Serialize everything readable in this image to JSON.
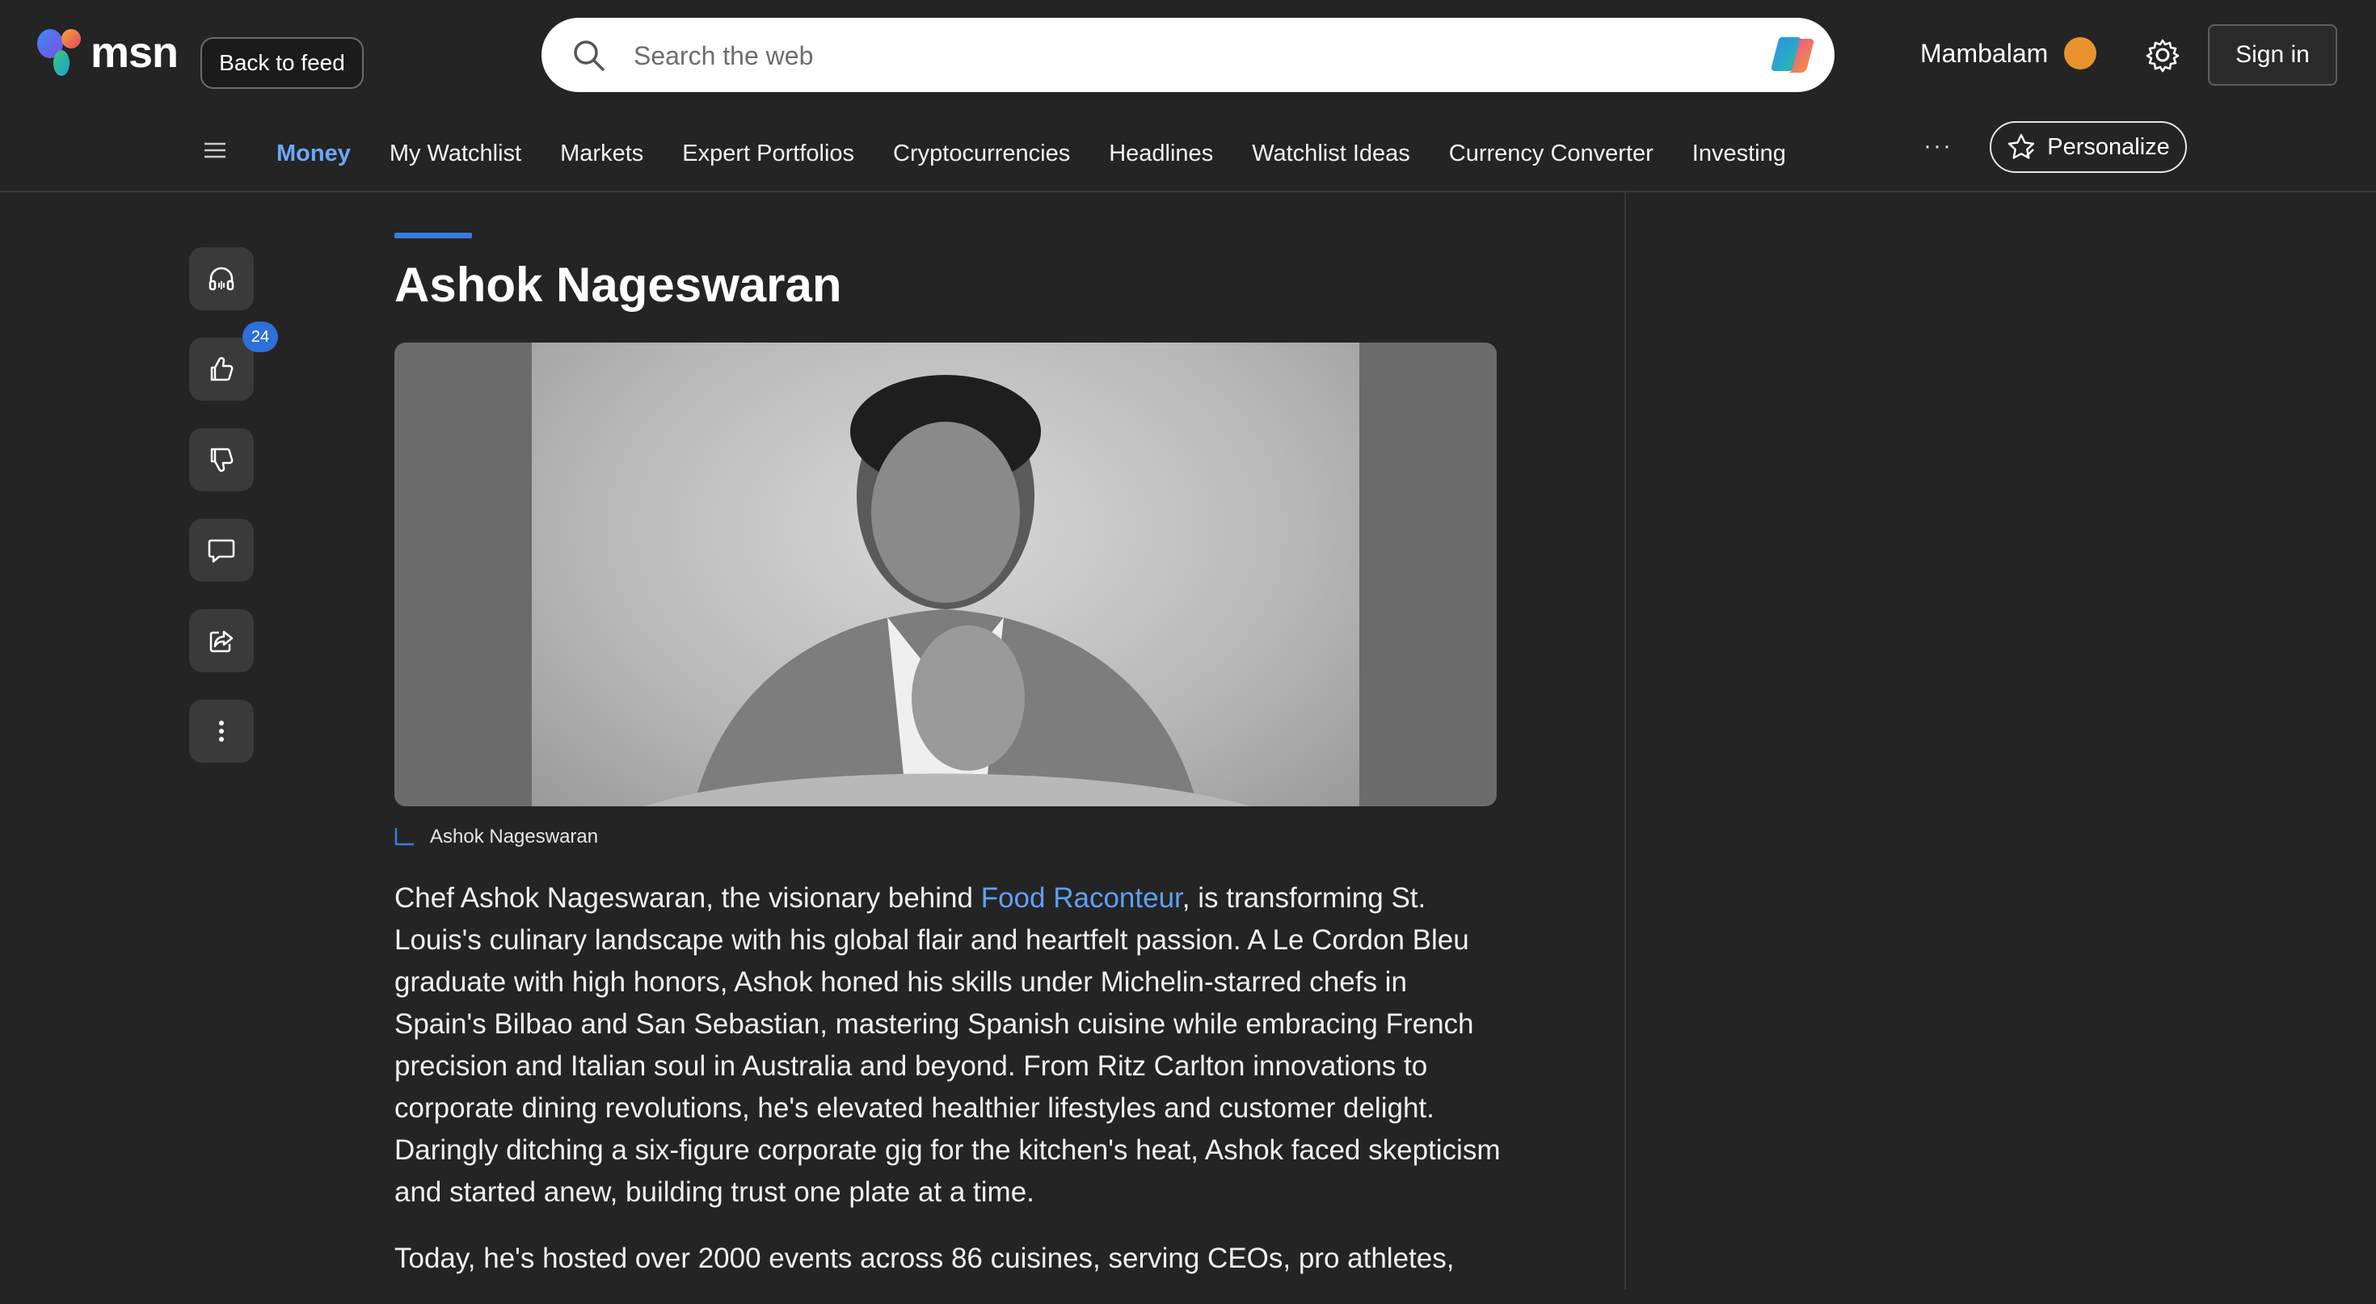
{
  "header": {
    "logo_text": "msn",
    "back_label": "Back to feed",
    "search_placeholder": "Search the web",
    "location": "Mambalam",
    "signin_label": "Sign in"
  },
  "nav": {
    "items": [
      "Money",
      "My Watchlist",
      "Markets",
      "Expert Portfolios",
      "Cryptocurrencies",
      "Headlines",
      "Watchlist Ideas",
      "Currency Converter",
      "Investing"
    ],
    "active": "Money",
    "more_label": "···",
    "personalize_label": "Personalize"
  },
  "actions": {
    "like_count": "24"
  },
  "article": {
    "title": "Ashok Nageswaran",
    "image_caption": "Ashok Nageswaran",
    "p1_before_link": "Chef Ashok Nageswaran, the visionary behind ",
    "p1_link": "Food Raconteur",
    "p1_after_link": ", is transforming St. Louis's culinary landscape with his global flair and heartfelt passion. A Le Cordon Bleu graduate with high honors, Ashok honed his skills under Michelin-starred chefs in Spain's Bilbao and San Sebastian, mastering Spanish cuisine while embracing French precision and Italian soul in Australia and beyond. From Ritz Carlton innovations to corporate dining revolutions, he's elevated healthier lifestyles and customer delight. Daringly ditching a six-figure corporate gig for the kitchen's heat, Ashok faced skepticism and started anew, building trust one plate at a time.",
    "p2": "Today, he's hosted over 2000 events across 86 cuisines, serving CEOs, pro athletes,"
  },
  "colors": {
    "background": "#242424",
    "accent": "#3a7be0",
    "link": "#5ea0f5",
    "badge": "#2e6fd8"
  }
}
